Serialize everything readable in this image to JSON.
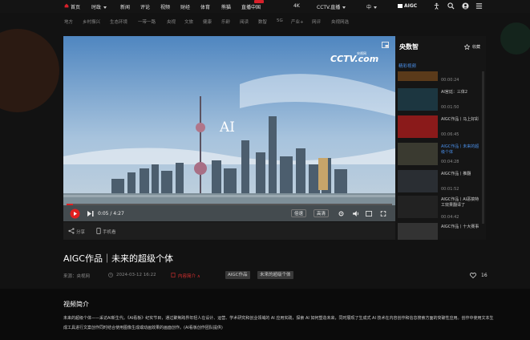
{
  "topnav": {
    "items": [
      "首页",
      "时政",
      "新闻",
      "评论",
      "视频",
      "财经",
      "体育",
      "熊猫",
      "直播中国",
      "4K",
      "CCTV.直播",
      "中",
      "AIGC"
    ],
    "hot_badge_color": "#d8202a"
  },
  "subnav": {
    "items": [
      "地方",
      "乡村振兴",
      "生态环境",
      "一带一路",
      "央视",
      "文旅",
      "健康",
      "乐龄",
      "阅读",
      "数智",
      "5G",
      "产业+",
      "网评",
      "央视网选"
    ]
  },
  "player": {
    "watermark": "CCTV.com",
    "watermark_sub": "央视网",
    "overlay_text": "AI",
    "time": "0:05 / 4:27",
    "progress_fraction": 0.019,
    "speed_label": "倍速",
    "quality_label": "高清"
  },
  "share": {
    "share_label": "分享",
    "mobile_label": "手机看"
  },
  "panel": {
    "title": "央数智",
    "fav_label": "收藏",
    "tab_label": "精彩视频",
    "items": [
      {
        "title": "",
        "duration": "00:00:24"
      },
      {
        "title": "AI宫廷：三体2",
        "duration": "00:01:50"
      },
      {
        "title": "AIGC作品丨马上好彩",
        "duration": "00:06:45"
      },
      {
        "title": "AIGC作品丨未来的超级个体",
        "duration": "00:04:28"
      },
      {
        "title": "AIGC作品丨推翻",
        "duration": "00:01:52"
      },
      {
        "title": "AIGC作品丨AI恶搞特工效果翻译了",
        "duration": "00:04:42"
      },
      {
        "title": "AIGC作品丨十大赛事",
        "duration": ""
      }
    ]
  },
  "video": {
    "title": "AIGC作品｜未来的超级个体",
    "source": "来源：央视网",
    "date": "2024-03-12 16:22",
    "more_label": "内容简介 ∧",
    "tags": [
      "AIGC作品",
      "未来的超级个体"
    ],
    "likes": "16"
  },
  "intro": {
    "heading": "视频简介",
    "body": "未来的超级个体——采访AI新生代。《AI看板》纪实节目，通过聚焦跨界年轻人在设计、运营、学术研究和创业领域的 AI 应用实践，探索 AI 如何塑造未来，同时展现了生成式 AI 技术在内容创作和信息搜索方面的突破性应用。创作中使用文本生成工具进行文案创作同时结合使用图像生成或动画效果的画面创作。(AI看板创作团队提供)"
  }
}
